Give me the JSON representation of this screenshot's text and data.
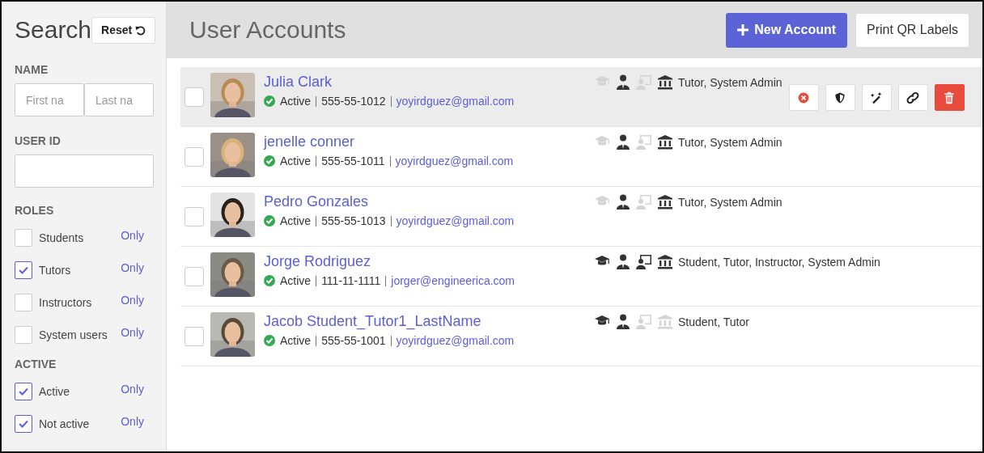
{
  "sidebar": {
    "title": "Search",
    "reset_button": "Reset",
    "name_label": "NAME",
    "first_name": {
      "placeholder": "First na"
    },
    "last_name": {
      "placeholder": "Last na"
    },
    "user_id_label": "USER ID",
    "filter_groups": [
      {
        "label": "ROLES",
        "options": [
          {
            "label": "Students",
            "checked": false,
            "only": "Only"
          },
          {
            "label": "Tutors",
            "checked": true,
            "only": "Only"
          },
          {
            "label": "Instructors",
            "checked": false,
            "only": "Only"
          },
          {
            "label": "System users",
            "checked": false,
            "only": "Only"
          }
        ]
      },
      {
        "label": "ACTIVE",
        "options": [
          {
            "label": "Active",
            "checked": true,
            "only": "Only"
          },
          {
            "label": "Not active",
            "checked": true,
            "only": "Only"
          }
        ]
      }
    ]
  },
  "header": {
    "title": "User Accounts",
    "new_button": "New Account",
    "print_button": "Print QR Labels"
  },
  "accounts": [
    {
      "name": "Julia Clark",
      "status": "Active",
      "phone": "555-55-1012",
      "email": "yoyirdguez@gmail.com",
      "highlighted": true,
      "roles": [
        {
          "kind": "student",
          "on": false
        },
        {
          "kind": "tutor",
          "on": true
        },
        {
          "kind": "instructor",
          "on": false
        },
        {
          "kind": "admin",
          "on": true
        }
      ],
      "role_text": "Tutor, System Admin",
      "actions": [
        {
          "kind": "deactivate"
        },
        {
          "kind": "permissions"
        },
        {
          "kind": "edit"
        },
        {
          "kind": "link"
        },
        {
          "kind": "delete"
        }
      ]
    },
    {
      "name": "jenelle conner",
      "status": "Active",
      "phone": "555-55-1011",
      "email": "yoyirdguez@gmail.com",
      "highlighted": false,
      "roles": [
        {
          "kind": "student",
          "on": false
        },
        {
          "kind": "tutor",
          "on": true
        },
        {
          "kind": "instructor",
          "on": false
        },
        {
          "kind": "admin",
          "on": true
        }
      ],
      "role_text": "Tutor, System Admin"
    },
    {
      "name": "Pedro Gonzales",
      "status": "Active",
      "phone": "555-55-1013",
      "email": "yoyirdguez@gmail.com",
      "highlighted": false,
      "roles": [
        {
          "kind": "student",
          "on": false
        },
        {
          "kind": "tutor",
          "on": true
        },
        {
          "kind": "instructor",
          "on": false
        },
        {
          "kind": "admin",
          "on": true
        }
      ],
      "role_text": "Tutor, System Admin"
    },
    {
      "name": "Jorge Rodriguez",
      "status": "Active",
      "phone": "111-11-1111",
      "email": "jorger@engineerica.com",
      "highlighted": false,
      "roles": [
        {
          "kind": "student",
          "on": true
        },
        {
          "kind": "tutor",
          "on": true
        },
        {
          "kind": "instructor",
          "on": true
        },
        {
          "kind": "admin",
          "on": true
        }
      ],
      "role_text": "Student, Tutor, Instructor, System Admin"
    },
    {
      "name": "Jacob Student_Tutor1_LastName",
      "status": "Active",
      "phone": "555-55-1001",
      "email": "yoyirdguez@gmail.com",
      "highlighted": false,
      "roles": [
        {
          "kind": "student",
          "on": true
        },
        {
          "kind": "tutor",
          "on": true
        },
        {
          "kind": "instructor",
          "on": false
        },
        {
          "kind": "admin",
          "on": false
        }
      ],
      "role_text": "Student, Tutor"
    }
  ]
}
